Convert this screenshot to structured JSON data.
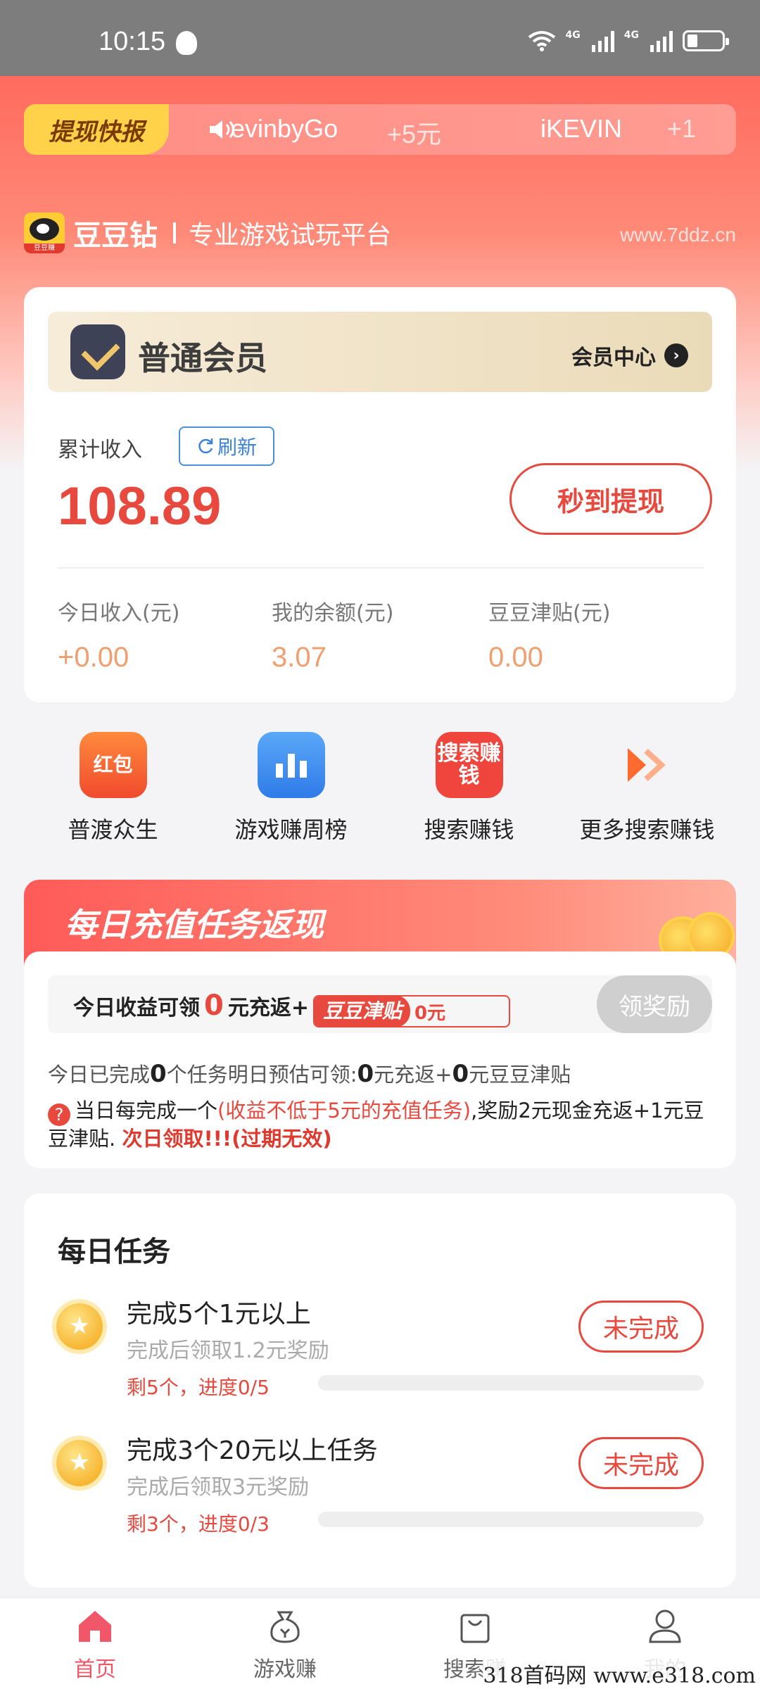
{
  "status": {
    "time": "10:15",
    "network": "4G"
  },
  "ticker": {
    "badge": "提现快报",
    "items": [
      {
        "user": "evinbyGo",
        "amount": "+5元"
      },
      {
        "user": "iKEVIN",
        "amount": "+1"
      }
    ]
  },
  "brand": {
    "logo_label": "豆豆赚",
    "name": "豆豆钻",
    "slogan": "专业游戏试玩平台",
    "url": "www.7ddz.cn"
  },
  "member": {
    "level": "普通会员",
    "center_label": "会员中心",
    "income_label": "累计收入",
    "refresh_label": "刷新",
    "income_value": "108.89",
    "withdraw_label": "秒到提现",
    "stats": [
      {
        "label": "今日收入(元)",
        "value": "+0.00"
      },
      {
        "label": "我的余额(元)",
        "value": "3.07"
      },
      {
        "label": "豆豆津贴(元)",
        "value": "0.00"
      }
    ]
  },
  "shortcuts": [
    {
      "label": "普渡众生",
      "icon": "red-envelope-icon",
      "icon_text": "红包",
      "color": "#ff6a3d"
    },
    {
      "label": "游戏赚周榜",
      "icon": "leaderboard-icon",
      "icon_text": "",
      "color": "#3a8ef0"
    },
    {
      "label": "搜索赚钱",
      "icon": "search-earn-icon",
      "icon_text": "搜索赚钱",
      "color": "#f0453d"
    },
    {
      "label": "更多搜索赚钱",
      "icon": "double-chevron-icon",
      "icon_text": "",
      "color": "#ff7a3d"
    }
  ],
  "recharge": {
    "title": "每日充值任务返现",
    "reward_prefix": "今日收益可领",
    "reward_amount": "0",
    "reward_mid": "元充返+",
    "subsidy_tag": "豆豆津贴",
    "subsidy_amount": "0元",
    "claim_label": "领奖励",
    "progress": {
      "p1": "今日已完成",
      "done": "0",
      "p2": "个任务明日预估可领:",
      "cash": "0",
      "p3": "元充返+",
      "subsidy": "0",
      "p4": "元豆豆津贴"
    },
    "rule": {
      "r1": "当日每完成一个",
      "r2": "(收益不低于5元的充值任务)",
      "r3": ",奖励2元现金充返+1元豆豆津贴. ",
      "r4": "次日领取!!!(过期无效)"
    }
  },
  "daily": {
    "title": "每日任务",
    "tasks": [
      {
        "title": "完成5个1元以上",
        "subtitle": "完成后领取1.2元奖励",
        "remain": "剩5个，进度0/5",
        "progress": 0,
        "status": "未完成"
      },
      {
        "title": "完成3个20元以上任务",
        "subtitle": "完成后领取3元奖励",
        "remain": "剩3个，进度0/3",
        "progress": 0,
        "status": "未完成"
      }
    ]
  },
  "tabs": [
    {
      "label": "首页",
      "icon": "home-icon",
      "active": true
    },
    {
      "label": "游戏赚",
      "icon": "money-bag-icon",
      "active": false
    },
    {
      "label": "搜索赚",
      "icon": "shopping-bag-icon",
      "active": false
    },
    {
      "label": "我的",
      "icon": "user-icon",
      "active": false
    }
  ],
  "watermark": "318首码网 www.e318.com",
  "colors": {
    "accent": "#e8493e",
    "hero": "#ff6a5e",
    "vip_gold": "#eadbb8",
    "tab_active": "#f0586a"
  }
}
